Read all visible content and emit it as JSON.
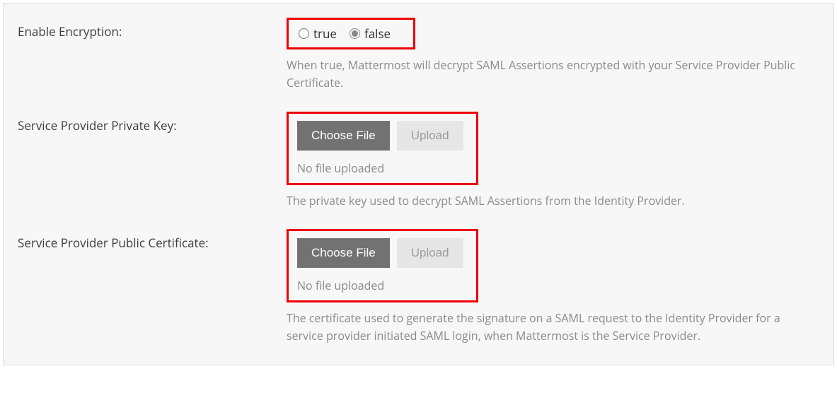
{
  "enableEncryption": {
    "label": "Enable Encryption:",
    "trueLabel": "true",
    "falseLabel": "false",
    "selected": "false",
    "help": "When true, Mattermost will decrypt SAML Assertions encrypted with your Service Provider Public Certificate."
  },
  "privateKey": {
    "label": "Service Provider Private Key:",
    "chooseLabel": "Choose File",
    "uploadLabel": "Upload",
    "statusText": "No file uploaded",
    "help": "The private key used to decrypt SAML Assertions from the Identity Provider."
  },
  "publicCert": {
    "label": "Service Provider Public Certificate:",
    "chooseLabel": "Choose File",
    "uploadLabel": "Upload",
    "statusText": "No file uploaded",
    "help": "The certificate used to generate the signature on a SAML request to the Identity Provider for a service provider initiated SAML login, when Mattermost is the Service Provider."
  }
}
